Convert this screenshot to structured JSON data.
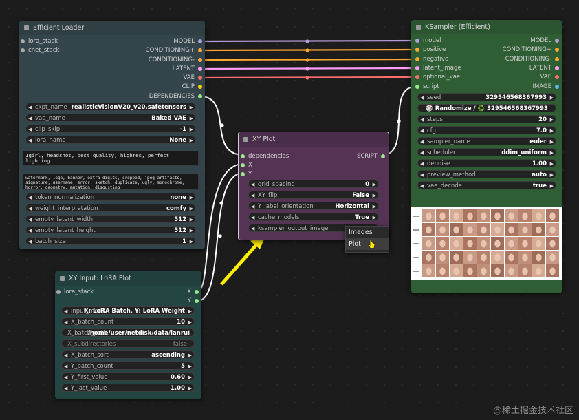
{
  "colors": {
    "model": "#b39ddb",
    "cond_pos": "#ffa931",
    "cond_neg": "#ffa931",
    "latent": "#ff9cf9",
    "vae": "#ff6e6e",
    "clip": "#ffd500",
    "script": "#98e98c",
    "white": "#ffffff"
  },
  "efficient_loader": {
    "title": "Efficient Loader",
    "inputs": [
      "lora_stack",
      "cnet_stack"
    ],
    "outputs": [
      "MODEL",
      "CONDITIONING+",
      "CONDITIONING-",
      "LATENT",
      "VAE",
      "CLIP",
      "DEPENDENCIES"
    ],
    "widgets": [
      {
        "label": "ckpt_name",
        "value": "realisticVisionV20_v20.safetensors"
      },
      {
        "label": "vae_name",
        "value": "Baked VAE"
      },
      {
        "label": "clip_skip",
        "value": "-1"
      },
      {
        "label": "lora_name",
        "value": "None"
      }
    ],
    "positive_prompt": "1girl, headshot, best quality, highres, perfect lighting",
    "negative_prompt": "watermark, logo, banner, extra digits, cropped, jpeg artifacts,\nsignature, username, error, sketch, duplicate, ugly, monochrome,\nhorror, geometry, mutation, disgusting",
    "widgets2": [
      {
        "label": "token_normalization",
        "value": "none"
      },
      {
        "label": "weight_interpretation",
        "value": "comfy"
      },
      {
        "label": "empty_latent_width",
        "value": "512"
      },
      {
        "label": "empty_latent_height",
        "value": "512"
      },
      {
        "label": "batch_size",
        "value": "1"
      }
    ]
  },
  "ksampler": {
    "title": "KSampler (Efficient)",
    "inputs": [
      "model",
      "positive",
      "negative",
      "latent_image",
      "optional_vae",
      "script"
    ],
    "outputs": [
      "MODEL",
      "CONDITIONING+",
      "CONDITIONING-",
      "LATENT",
      "VAE",
      "IMAGE"
    ],
    "seed": {
      "label": "seed",
      "value": "329546568367993"
    },
    "randomize_label": "🎲 Randomize / ♻️ 329546568367993",
    "widgets": [
      {
        "label": "steps",
        "value": "20"
      },
      {
        "label": "cfg",
        "value": "7.0"
      },
      {
        "label": "sampler_name",
        "value": "euler"
      },
      {
        "label": "scheduler",
        "value": "ddim_uniform"
      },
      {
        "label": "denoise",
        "value": "1.00"
      },
      {
        "label": "preview_method",
        "value": "auto"
      },
      {
        "label": "vae_decode",
        "value": "true"
      }
    ]
  },
  "xy_plot": {
    "title": "XY Plot",
    "inputs": [
      "dependencies",
      "X",
      "Y"
    ],
    "output": "SCRIPT",
    "widgets": [
      {
        "label": "grid_spacing",
        "value": "0"
      },
      {
        "label": "XY_flip",
        "value": "False"
      },
      {
        "label": "Y_label_orientation",
        "value": "Horizontal"
      },
      {
        "label": "cache_models",
        "value": "True"
      },
      {
        "label": "ksampler_output_image",
        "value": ""
      }
    ]
  },
  "context_menu": {
    "items": [
      "Images",
      "Plot"
    ]
  },
  "xy_input": {
    "title": "XY Input: LoRA Plot",
    "input": "lora_stack",
    "outputs": [
      "X",
      "Y"
    ],
    "widgets": [
      {
        "label": "input_mode",
        "value": "X: LoRA Batch, Y: LoRA Weight"
      },
      {
        "label": "X_batch_count",
        "value": "10"
      },
      {
        "label": "X_batch_path",
        "value": "/home/user/netdisk/data/lanrui"
      },
      {
        "label": "X_subdirectories",
        "value": "false"
      },
      {
        "label": "X_batch_sort",
        "value": "ascending"
      },
      {
        "label": "Y_batch_count",
        "value": "5"
      },
      {
        "label": "Y_first_value",
        "value": "0.60"
      },
      {
        "label": "Y_last_value",
        "value": "1.00"
      }
    ]
  },
  "watermark": "@稀土掘金技术社区"
}
